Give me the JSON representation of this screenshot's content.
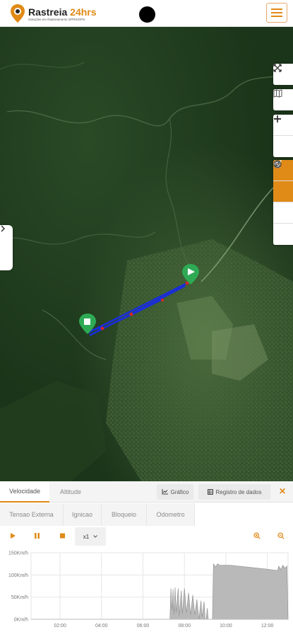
{
  "header": {
    "brand_name": "Rastreia",
    "brand_accent": "24hrs",
    "brand_tagline": "Soluções em Rastreamento GPRS/GPS",
    "menu_icon": "hamburger-icon",
    "accent_color": "#e08a17"
  },
  "map": {
    "tools_top": [
      "fullscreen-icon",
      "map-layers-icon"
    ],
    "zoom": [
      "zoom-in-icon",
      "zoom-out-icon"
    ],
    "tools_bottom": [
      "road-icon",
      "navigation-icon",
      "compass-icon",
      "bell-icon"
    ],
    "route_color": "#1a2fd6",
    "marker_color": "#2eaa55"
  },
  "panel": {
    "tabs": [
      {
        "label": "Velocidade",
        "active": true
      },
      {
        "label": "Altitude",
        "active": false
      }
    ],
    "buttons": {
      "chart": "Gráfico",
      "log": "Registro de dados"
    },
    "tabs_secondary": [
      "Tensao Externa",
      "Ignicao",
      "Bloqueio",
      "Odometro"
    ],
    "playback": {
      "speed": "x1"
    },
    "chart_data": {
      "type": "area",
      "y_ticks": [
        "150Km/h",
        "100Km/h",
        "50Km/h",
        "0Km/h"
      ],
      "y_range": [
        0,
        150
      ],
      "x_ticks": [
        "02:00",
        "04:00",
        "06:00",
        "08:00",
        "10:00",
        "12:00"
      ],
      "x_range_hours": [
        0.6,
        13.0
      ],
      "series": [
        {
          "points": [
            [
              7.3,
              0
            ],
            [
              7.35,
              70
            ],
            [
              7.4,
              20
            ],
            [
              7.45,
              68
            ],
            [
              7.5,
              10
            ],
            [
              7.55,
              72
            ],
            [
              7.6,
              15
            ],
            [
              7.7,
              70
            ],
            [
              7.75,
              8
            ],
            [
              7.85,
              65
            ],
            [
              7.9,
              12
            ],
            [
              8.0,
              70
            ],
            [
              8.1,
              15
            ],
            [
              8.2,
              60
            ],
            [
              8.3,
              10
            ],
            [
              8.4,
              55
            ],
            [
              8.5,
              10
            ],
            [
              8.6,
              45
            ],
            [
              8.7,
              0
            ],
            [
              8.8,
              42
            ],
            [
              8.85,
              5
            ],
            [
              8.95,
              40
            ],
            [
              9.0,
              0
            ],
            [
              9.05,
              0
            ],
            [
              9.1,
              25
            ],
            [
              9.15,
              0
            ],
            [
              9.35,
              0
            ],
            [
              9.4,
              125
            ],
            [
              9.5,
              118
            ],
            [
              9.6,
              125
            ],
            [
              9.7,
              122
            ],
            [
              10.2,
              122
            ],
            [
              11.0,
              118
            ],
            [
              12.0,
              113
            ],
            [
              12.5,
              110
            ],
            [
              12.55,
              120
            ],
            [
              12.65,
              112
            ],
            [
              12.75,
              122
            ],
            [
              12.85,
              115
            ],
            [
              12.95,
              120
            ],
            [
              13.0,
              0
            ]
          ]
        }
      ],
      "fill_color": "#b9b9b9",
      "grid": true
    }
  }
}
